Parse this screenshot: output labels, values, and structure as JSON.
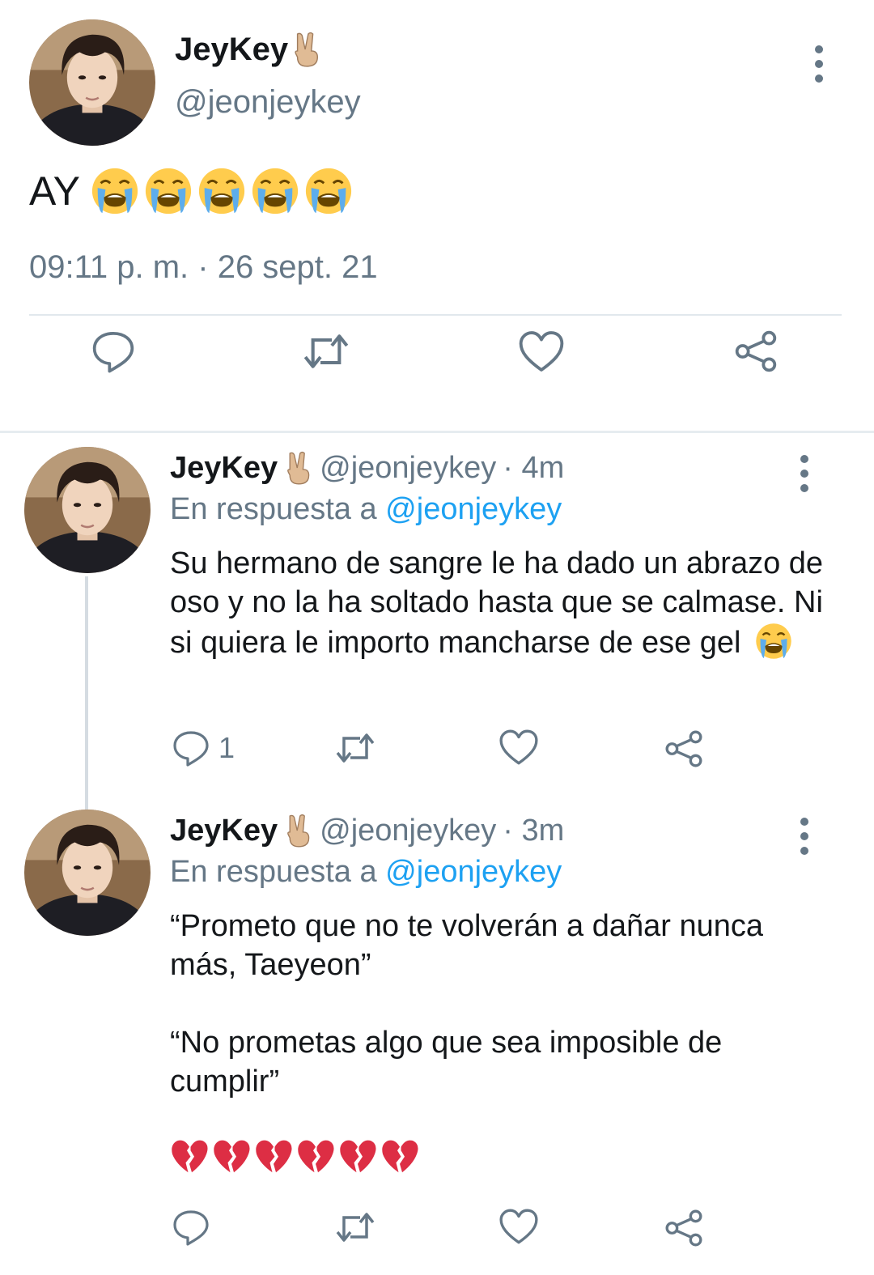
{
  "main_tweet": {
    "display_name": "JeyKey",
    "name_emoji": "victory-hand-emoji",
    "handle": "@jeonjeykey",
    "text": "AY",
    "text_emojis": [
      "loudly-crying-face",
      "loudly-crying-face",
      "loudly-crying-face",
      "loudly-crying-face",
      "loudly-crying-face"
    ],
    "timestamp": "09:11 p. m. · 26 sept. 21"
  },
  "replies": [
    {
      "display_name": "JeyKey",
      "handle": "@jeonjeykey",
      "time": "· 4m",
      "reply_prefix": "En respuesta a",
      "reply_mention": "@jeonjeykey",
      "text": "Su hermano de sangre le ha dado un abrazo de oso y no la ha soltado hasta que se calmase. Ni si quiera le importo mancharse de ese gel",
      "reply_count": "1"
    },
    {
      "display_name": "JeyKey",
      "handle": "@jeonjeykey",
      "time": "· 3m",
      "reply_prefix": "En respuesta a",
      "reply_mention": "@jeonjeykey",
      "paragraph_1": "“Prometo que no te volverán a dañar nunca más, Taeyeon”",
      "paragraph_2": "“No prometas algo que sea imposible de cumplir”",
      "emojis": [
        "broken-heart",
        "broken-heart",
        "broken-heart",
        "broken-heart",
        "broken-heart",
        "broken-heart"
      ]
    }
  ],
  "colors": {
    "text": "#14171a",
    "secondary": "#657786",
    "link": "#1da1f2",
    "divider": "#e1e8ed"
  }
}
